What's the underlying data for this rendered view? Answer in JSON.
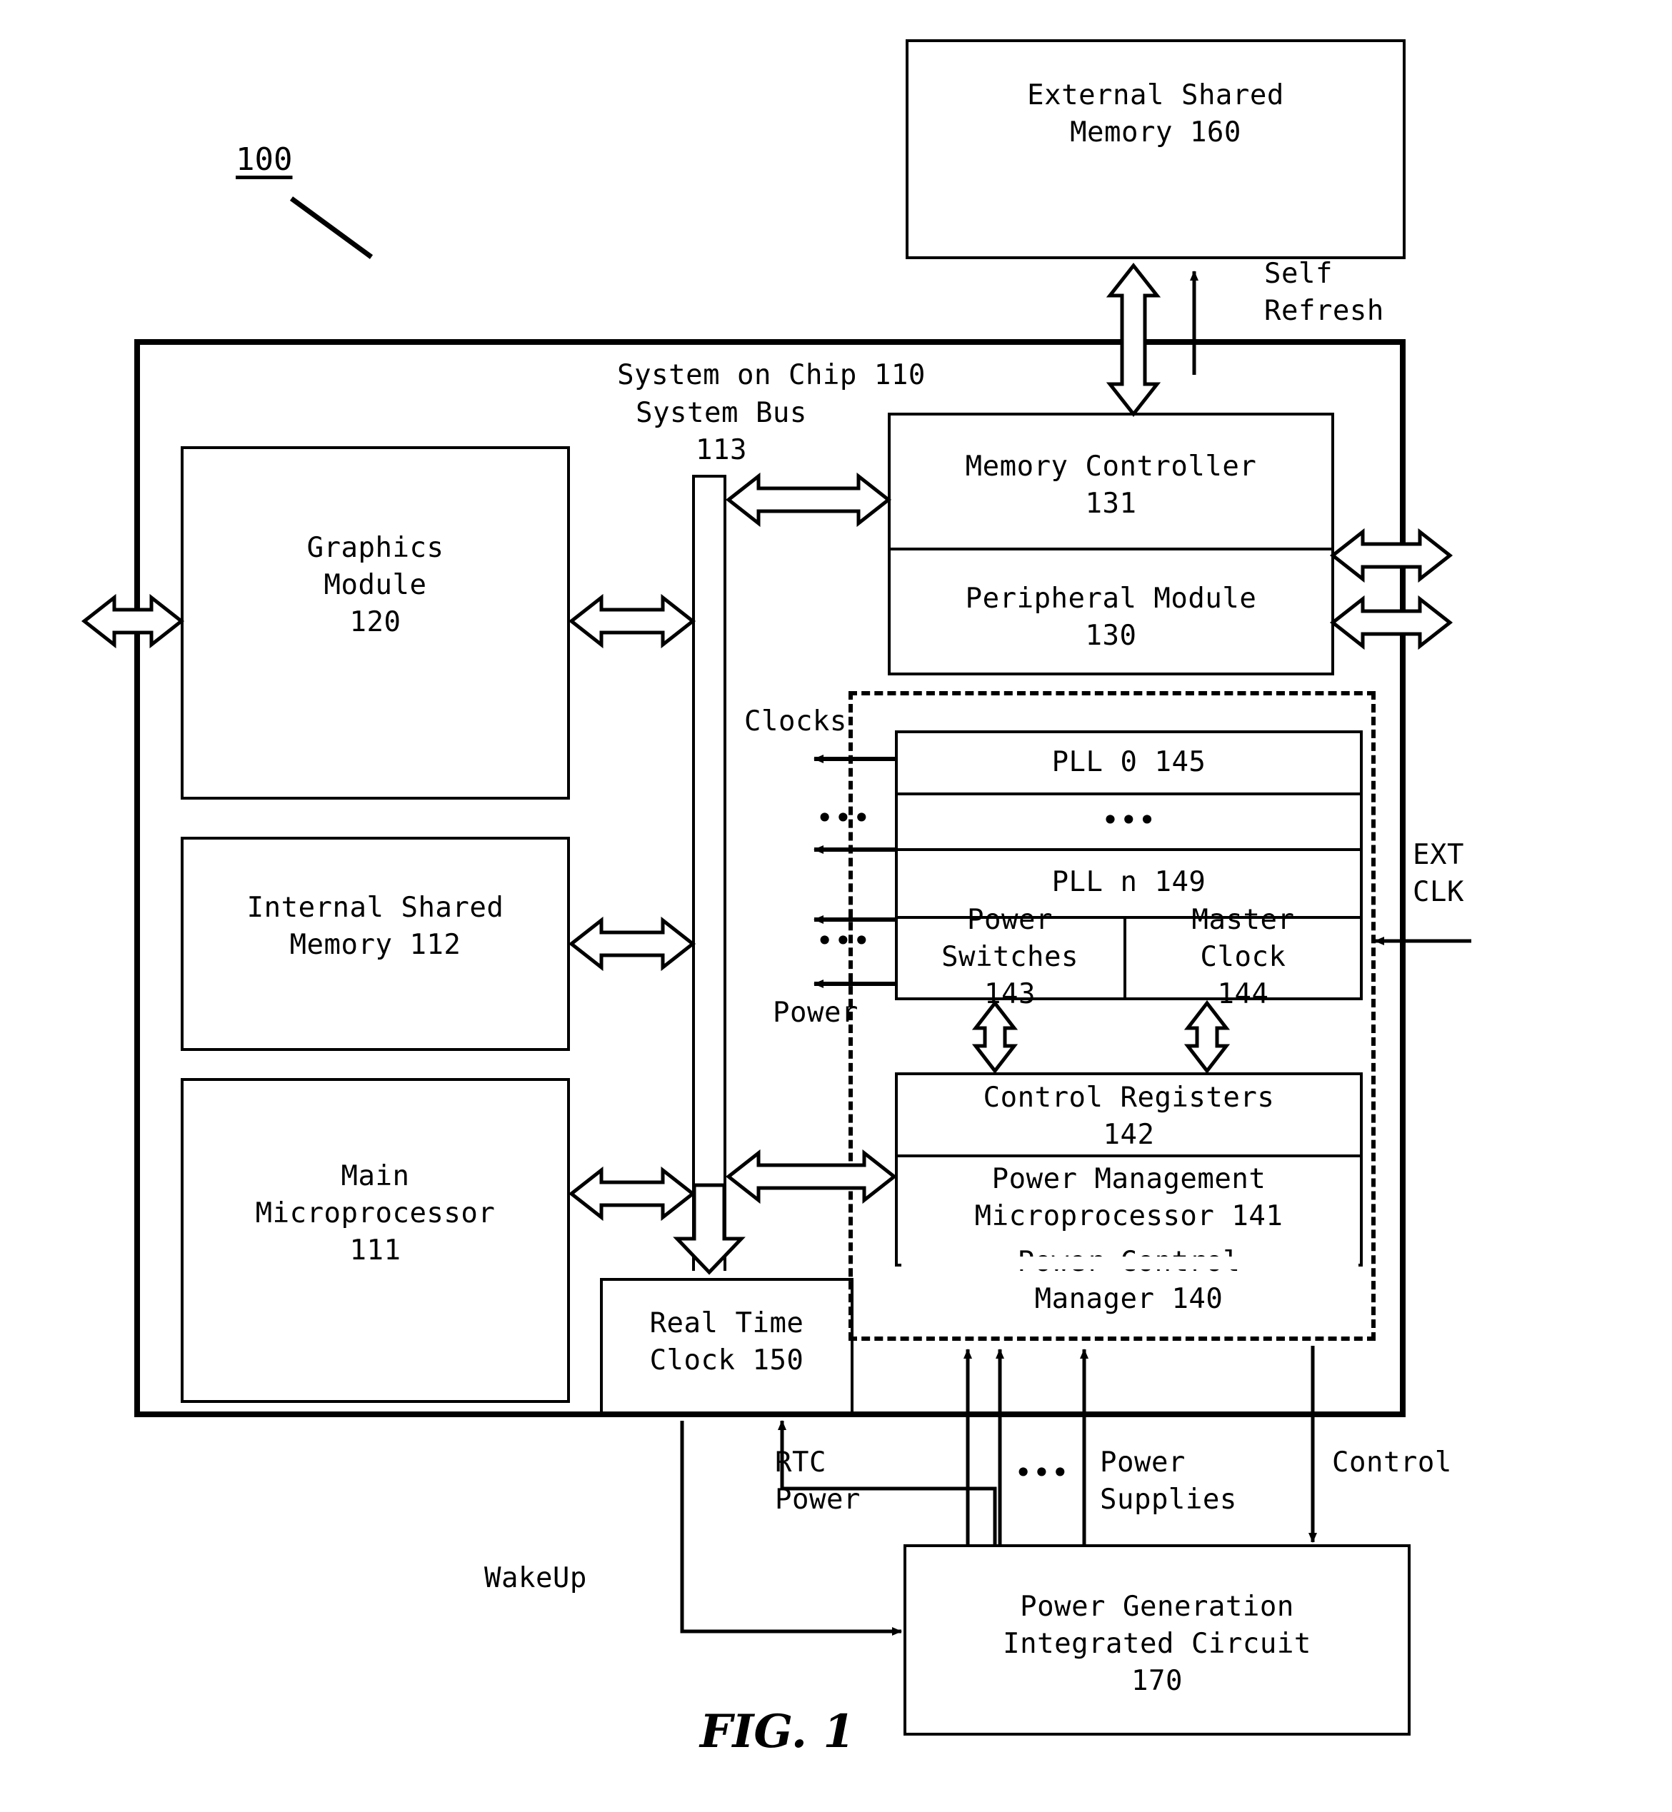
{
  "figure": {
    "caption": "FIG. 1",
    "system_ref": "100"
  },
  "blocks": {
    "external_shared_memory": "External Shared\nMemory 160",
    "system_on_chip": "System on Chip 110",
    "system_bus": "System Bus\n113",
    "graphics_module": "Graphics\nModule\n120",
    "internal_shared_memory": "Internal Shared\nMemory 112",
    "main_microprocessor": "Main\nMicroprocessor\n111",
    "memory_controller": "Memory Controller\n131",
    "peripheral_module": "Peripheral Module\n130",
    "pll_0": "PLL 0 145",
    "pll_ellipsis": "•••",
    "pll_n": "PLL n 149",
    "power_switches": "Power\nSwitches\n143",
    "master_clock": "Master\nClock\n144",
    "control_registers": "Control Registers\n142",
    "power_management_microprocessor": "Power Management\nMicroprocessor 141",
    "power_control_manager": "Power Control\nManager 140",
    "real_time_clock": "Real Time\nClock 150",
    "power_generation_ic": "Power Generation\nIntegrated Circuit\n170"
  },
  "signals": {
    "self_refresh": "Self\nRefresh",
    "clocks": "Clocks",
    "power": "Power",
    "ext_clk": "EXT\nCLK",
    "rtc_power": "RTC\nPower",
    "power_supplies": "Power\nSupplies",
    "control": "Control",
    "wakeup": "WakeUp",
    "ellipsis_clocks_1": "•••",
    "ellipsis_clocks_2": "•••",
    "ellipsis_supplies": "•••"
  },
  "colors": {
    "stroke": "#000000",
    "background": "#ffffff"
  }
}
